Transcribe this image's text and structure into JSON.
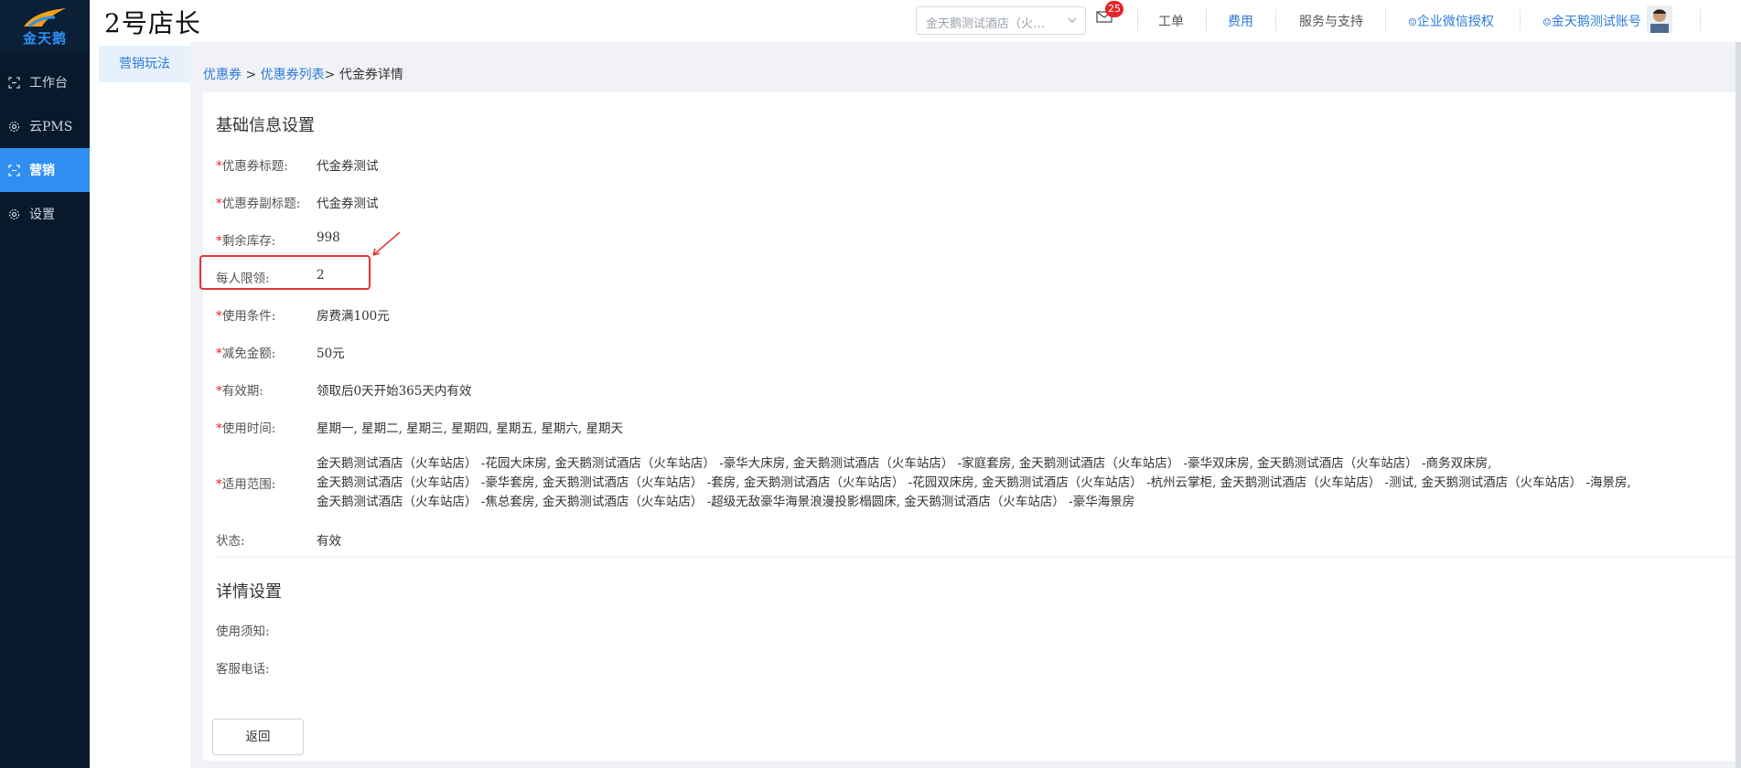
{
  "app": {
    "logo_text": "金天鹅",
    "title": "2号店长"
  },
  "sidebar": {
    "items": [
      {
        "label": "工作台",
        "icon": "workbench-icon",
        "active": false
      },
      {
        "label": "云PMS",
        "icon": "gear-icon",
        "active": false
      },
      {
        "label": "营销",
        "icon": "marketing-icon",
        "active": true
      },
      {
        "label": "设置",
        "icon": "gear-icon",
        "active": false
      }
    ]
  },
  "header": {
    "hotel_select": "金天鹅测试酒店（火…",
    "notification_count": "25",
    "nav": {
      "workorder": "工单",
      "fees": "费用",
      "service": "服务与支持",
      "wechat_auth": "企业微信授权",
      "account": "金天鹅测试账号"
    }
  },
  "subnav": {
    "item": "营销玩法"
  },
  "breadcrumb": {
    "crumb1": "优惠券",
    "sep1": " > ",
    "crumb2": "优惠券列表",
    "sep2": "> ",
    "current": "代金券详情"
  },
  "basic": {
    "section_title": "基础信息设置",
    "fields": [
      {
        "required": true,
        "label": "优惠券标题:",
        "value": "代金券测试"
      },
      {
        "required": true,
        "label": "优惠券副标题:",
        "value": "代金券测试"
      },
      {
        "required": true,
        "label": "剩余库存:",
        "value": "998"
      },
      {
        "required": false,
        "label": "每人限领:",
        "value": "2"
      },
      {
        "required": true,
        "label": "使用条件:",
        "value": "房费满100元"
      },
      {
        "required": true,
        "label": "减免金额:",
        "value": "50元"
      },
      {
        "required": true,
        "label": "有效期:",
        "value": "领取后0天开始365天内有效"
      },
      {
        "required": true,
        "label": "使用时间:",
        "value": "星期一, 星期二, 星期三, 星期四, 星期五, 星期六, 星期天"
      }
    ],
    "scope_label": "适用范围:",
    "scope_lines": [
      "金天鹅测试酒店（火车站店） -花园大床房, 金天鹅测试酒店（火车站店） -豪华大床房, 金天鹅测试酒店（火车站店） -家庭套房, 金天鹅测试酒店（火车站店） -豪华双床房, 金天鹅测试酒店（火车站店） -商务双床房,",
      "金天鹅测试酒店（火车站店） -豪华套房, 金天鹅测试酒店（火车站店） -套房, 金天鹅测试酒店（火车站店） -花园双床房, 金天鹅测试酒店（火车站店） -杭州云掌柜, 金天鹅测试酒店（火车站店） -测试, 金天鹅测试酒店（火车站店） -海景房,",
      "金天鹅测试酒店（火车站店） -焦总套房, 金天鹅测试酒店（火车站店） -超级无敌豪华海景浪漫投影榻圆床, 金天鹅测试酒店（火车站店） -豪华海景房"
    ],
    "status_label": "状态:",
    "status_value": "有效"
  },
  "detail": {
    "section_title": "详情设置",
    "notice_label": "使用须知:",
    "phone_label": "客服电话:"
  },
  "actions": {
    "back": "返回"
  },
  "colors": {
    "sidebar_bg": "#07192b",
    "accent": "#2e8ff0",
    "link": "#2e7bd8",
    "required": "#e6252b",
    "annotation": "#e63232"
  }
}
